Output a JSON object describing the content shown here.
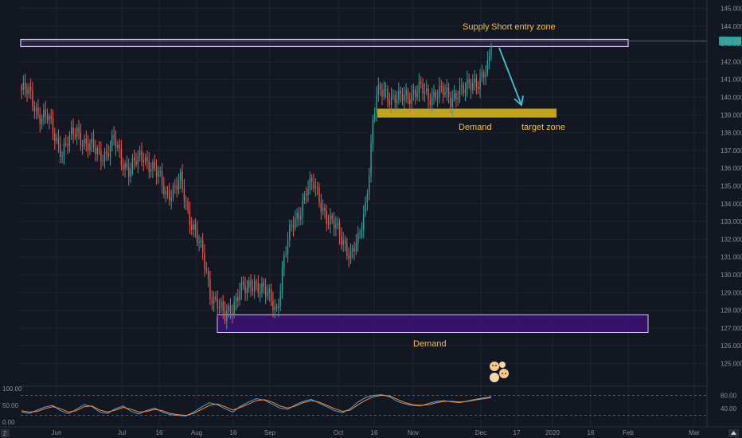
{
  "chart_data": {
    "type": "candlestick",
    "title": "",
    "y_axis": {
      "ticks": [
        "145.000",
        "144.000",
        "143.000",
        "142.000",
        "141.000",
        "140.000",
        "139.000",
        "138.000",
        "137.000",
        "136.000",
        "135.000",
        "134.000",
        "133.000",
        "132.000",
        "131.000",
        "130.000",
        "129.000",
        "128.000",
        "127.000",
        "126.000",
        "125.000"
      ],
      "ylim": [
        124.8,
        145.2
      ],
      "current_price_label": "143.159",
      "current_price": 143.159
    },
    "x_axis": {
      "ticks": [
        "Jun",
        "Jul",
        "16",
        "Aug",
        "16",
        "Sep",
        "Oct",
        "16",
        "Nov",
        "Dec",
        "17",
        "2020",
        "16",
        "Feb",
        "Mar"
      ]
    },
    "annotations": {
      "supply_label": "Supply",
      "short_label": "Short entry zone",
      "demand_upper_label": "Demand",
      "target_label": "target zone",
      "demand_lower_label": "Demand"
    },
    "zones": {
      "supply": {
        "low": 142.85,
        "high": 143.25,
        "color": "#8a5cd6"
      },
      "demand_upper": {
        "low": 138.85,
        "high": 139.35,
        "color": "#d4b51c"
      },
      "demand_lower": {
        "low": 126.75,
        "high": 127.75,
        "color": "#3a1170"
      }
    },
    "colors": {
      "up": "#26a69a",
      "down": "#ef5350",
      "price_line": "#26a69a",
      "arrow": "#40c4d8"
    },
    "ohlc_anchors": [
      [
        0,
        140.4
      ],
      [
        4,
        140.2
      ],
      [
        9,
        139.1
      ],
      [
        14,
        138.8
      ],
      [
        18,
        137.8
      ],
      [
        22,
        137.0
      ],
      [
        26,
        137.6
      ],
      [
        30,
        138.1
      ],
      [
        34,
        137.5
      ],
      [
        38,
        137.1
      ],
      [
        42,
        136.8
      ],
      [
        46,
        136.9
      ],
      [
        50,
        137.5
      ],
      [
        54,
        136.5
      ],
      [
        58,
        136.0
      ],
      [
        62,
        136.3
      ],
      [
        66,
        136.7
      ],
      [
        70,
        136.2
      ],
      [
        74,
        135.5
      ],
      [
        78,
        134.6
      ],
      [
        82,
        134.8
      ],
      [
        86,
        135.2
      ],
      [
        90,
        133.5
      ],
      [
        94,
        132.5
      ],
      [
        98,
        131.0
      ],
      [
        102,
        129.0
      ],
      [
        106,
        128.5
      ],
      [
        110,
        127.5
      ],
      [
        114,
        128.2
      ],
      [
        118,
        129.3
      ],
      [
        122,
        129.0
      ],
      [
        126,
        129.6
      ],
      [
        130,
        129.3
      ],
      [
        134,
        128.6
      ],
      [
        138,
        128.0
      ],
      [
        142,
        131.0
      ],
      [
        146,
        132.6
      ],
      [
        150,
        133.5
      ],
      [
        154,
        134.8
      ],
      [
        158,
        135.0
      ],
      [
        162,
        134.1
      ],
      [
        166,
        133.0
      ],
      [
        170,
        132.6
      ],
      [
        174,
        132.0
      ],
      [
        178,
        131.0
      ],
      [
        182,
        131.8
      ],
      [
        186,
        134.0
      ],
      [
        188,
        136.0
      ],
      [
        190,
        138.5
      ],
      [
        192,
        140.0
      ],
      [
        196,
        140.4
      ],
      [
        200,
        140.0
      ],
      [
        204,
        139.8
      ],
      [
        208,
        140.1
      ],
      [
        212,
        140.3
      ],
      [
        216,
        140.4
      ],
      [
        220,
        140.0
      ],
      [
        224,
        140.3
      ],
      [
        228,
        140.2
      ],
      [
        232,
        139.9
      ],
      [
        236,
        140.4
      ],
      [
        240,
        140.3
      ],
      [
        244,
        140.9
      ],
      [
        248,
        141.0
      ],
      [
        252,
        141.5
      ],
      [
        253,
        142.0
      ],
      [
        254,
        143.1
      ]
    ],
    "oscillator": {
      "ticks": [
        "100.00",
        "50.00",
        "0.00"
      ],
      "right_ticks": [
        "80.00",
        "40.00"
      ],
      "range": [
        0,
        100
      ],
      "series": [
        {
          "color": "#4fa3e0",
          "values": [
            30,
            26,
            36,
            45,
            50,
            34,
            25,
            38,
            52,
            47,
            30,
            26,
            40,
            48,
            32,
            24,
            35,
            42,
            30,
            22,
            20,
            18,
            30,
            45,
            58,
            52,
            40,
            30,
            48,
            60,
            70,
            66,
            54,
            42,
            38,
            52,
            62,
            68,
            57,
            46,
            34,
            28,
            40,
            60,
            74,
            80,
            82,
            76,
            62,
            54,
            50,
            48,
            56,
            62,
            64,
            60,
            58,
            63,
            68,
            72,
            76
          ]
        },
        {
          "color": "#ff8c2e",
          "values": [
            34,
            30,
            32,
            40,
            46,
            40,
            30,
            34,
            46,
            48,
            36,
            30,
            36,
            44,
            38,
            30,
            32,
            38,
            34,
            26,
            22,
            20,
            26,
            38,
            50,
            54,
            46,
            36,
            44,
            54,
            64,
            67,
            60,
            48,
            42,
            48,
            58,
            64,
            60,
            50,
            40,
            32,
            36,
            52,
            66,
            76,
            80,
            78,
            68,
            58,
            52,
            50,
            52,
            58,
            62,
            62,
            60,
            62,
            66,
            70,
            73
          ]
        }
      ]
    }
  }
}
